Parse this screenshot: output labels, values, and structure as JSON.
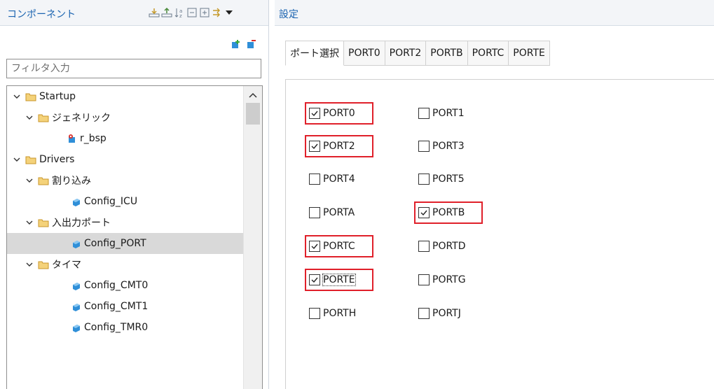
{
  "left_panel": {
    "title": "コンポーネント",
    "filter_placeholder": "フィルタ入力",
    "tree": [
      {
        "label": "Startup",
        "kind": "folder"
      },
      {
        "label": "ジェネリック",
        "kind": "folder"
      },
      {
        "label": "r_bsp",
        "kind": "component"
      },
      {
        "label": "Drivers",
        "kind": "folder"
      },
      {
        "label": "割り込み",
        "kind": "folder"
      },
      {
        "label": "Config_ICU",
        "kind": "component"
      },
      {
        "label": "入出力ポート",
        "kind": "folder"
      },
      {
        "label": "Config_PORT",
        "kind": "component",
        "selected": true
      },
      {
        "label": "タイマ",
        "kind": "folder"
      },
      {
        "label": "Config_CMT0",
        "kind": "component"
      },
      {
        "label": "Config_CMT1",
        "kind": "component"
      },
      {
        "label": "Config_TMR0",
        "kind": "component"
      }
    ]
  },
  "right_panel": {
    "title": "設定",
    "tabs": [
      "ポート選択",
      "PORT0",
      "PORT2",
      "PORTB",
      "PORTC",
      "PORTE"
    ],
    "ports": [
      {
        "label": "PORT0",
        "checked": true
      },
      {
        "label": "PORT1",
        "checked": false
      },
      {
        "label": "PORT2",
        "checked": true
      },
      {
        "label": "PORT3",
        "checked": false
      },
      {
        "label": "PORT4",
        "checked": false
      },
      {
        "label": "PORT5",
        "checked": false
      },
      {
        "label": "PORTA",
        "checked": false
      },
      {
        "label": "PORTB",
        "checked": true
      },
      {
        "label": "PORTC",
        "checked": true
      },
      {
        "label": "PORTD",
        "checked": false
      },
      {
        "label": "PORTE",
        "checked": true
      },
      {
        "label": "PORTG",
        "checked": false
      },
      {
        "label": "PORTH",
        "checked": false
      },
      {
        "label": "PORTJ",
        "checked": false
      }
    ]
  },
  "colors": {
    "title": "#1a63b0",
    "highlight": "#e0202a",
    "selected_row": "#d9d9d9",
    "folder": "#e3b64a",
    "component": "#2f8fd8"
  }
}
